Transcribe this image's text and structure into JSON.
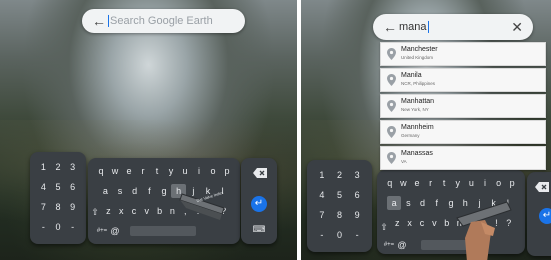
{
  "left": {
    "search": {
      "placeholder": "Search Google Earth",
      "back_icon": "arrow-left-icon"
    },
    "numpad": {
      "keys": [
        "1",
        "2",
        "3",
        "4",
        "5",
        "6",
        "7",
        "8",
        "9",
        "-",
        "0",
        "-"
      ]
    },
    "letters": {
      "row1": [
        "q",
        "w",
        "e",
        "r",
        "t",
        "y",
        "u",
        "i",
        "o",
        "p"
      ],
      "row2": [
        "a",
        "s",
        "d",
        "f",
        "g",
        "h",
        "j",
        "k",
        "l"
      ],
      "row3": [
        "z",
        "x",
        "c",
        "v",
        "b",
        "n",
        ",",
        ".",
        "!",
        "?"
      ],
      "symbols_label": "#+=",
      "at_label": "@",
      "highlighted_key": "h"
    },
    "controller_label": "Dat Valve Index"
  },
  "right": {
    "search": {
      "value": "mana",
      "back_icon": "arrow-left-icon",
      "clear_icon": "close-icon"
    },
    "suggestions": [
      {
        "name": "Manchester",
        "sub": "United Kingdom"
      },
      {
        "name": "Manila",
        "sub": "NCR, Philippines"
      },
      {
        "name": "Manhattan",
        "sub": "New York, NY"
      },
      {
        "name": "Mannheim",
        "sub": "Germany"
      },
      {
        "name": "Manassas",
        "sub": "VA"
      }
    ],
    "numpad": {
      "keys": [
        "1",
        "2",
        "3",
        "4",
        "5",
        "6",
        "7",
        "8",
        "9",
        "-",
        "0",
        "-"
      ]
    },
    "letters": {
      "row1": [
        "q",
        "w",
        "e",
        "r",
        "t",
        "y",
        "u",
        "i",
        "o",
        "p"
      ],
      "row2": [
        "a",
        "s",
        "d",
        "f",
        "g",
        "h",
        "j",
        "k",
        "l"
      ],
      "row3": [
        "z",
        "x",
        "c",
        "v",
        "b",
        "n",
        ",",
        ".",
        "!",
        "?"
      ],
      "symbols_label": "#+=",
      "at_label": "@",
      "highlighted_key": "a"
    }
  },
  "colors": {
    "accent": "#1a73e8",
    "keyboard_bg": "#3a3f44"
  }
}
